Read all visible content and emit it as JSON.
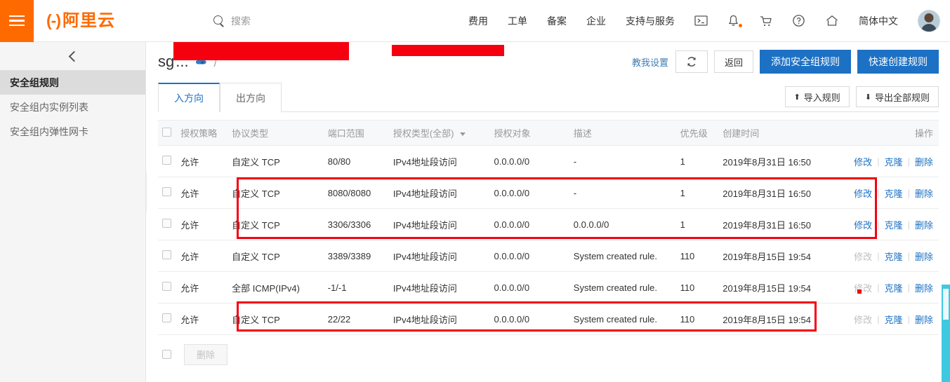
{
  "topbar": {
    "menu_icon": "hamburger-icon",
    "logo_mark": "(-)",
    "logo_text": "阿里云",
    "search_placeholder": "搜索",
    "nav_items": [
      {
        "label": "费用"
      },
      {
        "label": "工单"
      },
      {
        "label": "备案"
      },
      {
        "label": "企业"
      },
      {
        "label": "支持与服务"
      }
    ],
    "icons": [
      {
        "name": "terminal-icon",
        "glyph": "⌨"
      },
      {
        "name": "bell-icon",
        "glyph": "℗"
      },
      {
        "name": "cart-icon",
        "glyph": "℗"
      },
      {
        "name": "help-icon",
        "glyph": "?"
      },
      {
        "name": "home-icon",
        "glyph": "⌂"
      }
    ],
    "language": "简体中文",
    "avatar": "user-avatar"
  },
  "sidebar": {
    "collapse_icon": "chevron-left-icon",
    "items": [
      {
        "label": "安全组规则",
        "active": true
      },
      {
        "label": "安全组内实例列表",
        "active": false
      },
      {
        "label": "安全组内弹性网卡",
        "active": false
      }
    ],
    "handle_icon": "chevron-right-icon"
  },
  "page": {
    "title_prefix": "sg",
    "title_ellipsis": "...",
    "copy_icon": "cloud-copy-icon",
    "breadcrumb_separator": "/",
    "teach_link": "教我设置",
    "refresh_icon": "refresh-icon",
    "back_button": "返回",
    "add_rule_button": "添加安全组规则",
    "quick_create_button": "快速创建规则"
  },
  "tabs": [
    {
      "label": "入方向",
      "active": true
    },
    {
      "label": "出方向",
      "active": false
    }
  ],
  "tab_actions": {
    "import_icon": "upload-icon",
    "import_label": "导入规则",
    "export_icon": "download-icon",
    "export_label": "导出全部规则"
  },
  "table": {
    "headers": {
      "policy": "授权策略",
      "protocol": "协议类型",
      "port": "端口范围",
      "auth_type": "授权类型(全部)",
      "auth_object": "授权对象",
      "description": "描述",
      "priority": "优先级",
      "created": "创建时间",
      "operation": "操作"
    },
    "ops": {
      "modify": "修改",
      "clone": "克隆",
      "delete": "删除",
      "divider": "|"
    },
    "rows": [
      {
        "policy": "允许",
        "protocol": "自定义 TCP",
        "port": "80/80",
        "auth_type": "IPv4地址段访问",
        "auth_object": "0.0.0.0/0",
        "description": "-",
        "priority": "1",
        "created": "2019年8月31日 16:50",
        "modify_disabled": false
      },
      {
        "policy": "允许",
        "protocol": "自定义 TCP",
        "port": "8080/8080",
        "auth_type": "IPv4地址段访问",
        "auth_object": "0.0.0.0/0",
        "description": "-",
        "priority": "1",
        "created": "2019年8月31日 16:50",
        "modify_disabled": false
      },
      {
        "policy": "允许",
        "protocol": "自定义 TCP",
        "port": "3306/3306",
        "auth_type": "IPv4地址段访问",
        "auth_object": "0.0.0.0/0",
        "description": "0.0.0.0/0",
        "priority": "1",
        "created": "2019年8月31日 16:50",
        "modify_disabled": false
      },
      {
        "policy": "允许",
        "protocol": "自定义 TCP",
        "port": "3389/3389",
        "auth_type": "IPv4地址段访问",
        "auth_object": "0.0.0.0/0",
        "description": "System created rule.",
        "priority": "110",
        "created": "2019年8月15日 19:54",
        "modify_disabled": true
      },
      {
        "policy": "允许",
        "protocol": "全部 ICMP(IPv4)",
        "port": "-1/-1",
        "auth_type": "IPv4地址段访问",
        "auth_object": "0.0.0.0/0",
        "description": "System created rule.",
        "priority": "110",
        "created": "2019年8月15日 19:54",
        "modify_disabled": true
      },
      {
        "policy": "允许",
        "protocol": "自定义 TCP",
        "port": "22/22",
        "auth_type": "IPv4地址段访问",
        "auth_object": "0.0.0.0/0",
        "description": "System created rule.",
        "priority": "110",
        "created": "2019年8月15日 19:54",
        "modify_disabled": true
      }
    ]
  },
  "footer": {
    "delete_button": "删除"
  },
  "colors": {
    "brand_orange": "#ff6a00",
    "primary_blue": "#1d71c4",
    "annotation_red": "#f5000f",
    "link_blue": "#1d71c4",
    "scrollbar_cyan": "#3ec9e0"
  }
}
